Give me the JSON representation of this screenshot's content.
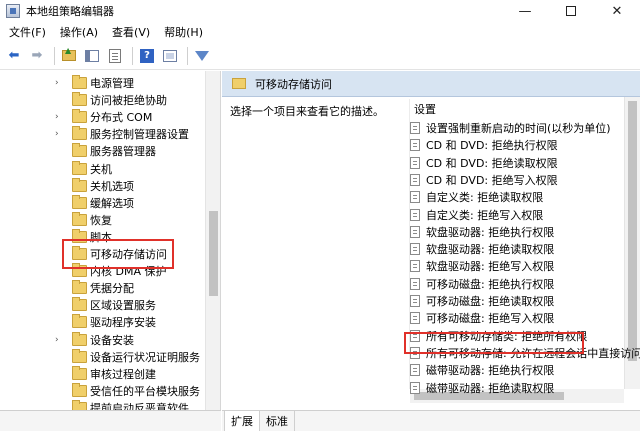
{
  "window": {
    "title": "本地组策略编辑器",
    "min": "—",
    "close": "✕"
  },
  "menu": [
    "文件(F)",
    "操作(A)",
    "查看(V)",
    "帮助(H)"
  ],
  "toolbar": {
    "icons": [
      "back-icon",
      "forward-icon",
      "folder-up-icon",
      "show-hide-tree-icon",
      "export-list-icon",
      "help-icon",
      "properties-icon",
      "filter-icon"
    ],
    "back_glyph": "⬅",
    "fwd_glyph": "➡"
  },
  "tree": {
    "items": [
      {
        "label": "电源管理",
        "arrow": "›"
      },
      {
        "label": "访问被拒绝协助",
        "arrow": ""
      },
      {
        "label": "分布式 COM",
        "arrow": "›"
      },
      {
        "label": "服务控制管理器设置",
        "arrow": "›"
      },
      {
        "label": "服务器管理器",
        "arrow": ""
      },
      {
        "label": "关机",
        "arrow": ""
      },
      {
        "label": "关机选项",
        "arrow": ""
      },
      {
        "label": "缓解选项",
        "arrow": ""
      },
      {
        "label": "恢复",
        "arrow": ""
      },
      {
        "label": "脚本",
        "arrow": ""
      },
      {
        "label": "可移动存储访问",
        "arrow": "",
        "selected": true
      },
      {
        "label": "内核 DMA 保护",
        "arrow": ""
      },
      {
        "label": "凭据分配",
        "arrow": ""
      },
      {
        "label": "区域设置服务",
        "arrow": ""
      },
      {
        "label": "驱动程序安装",
        "arrow": ""
      },
      {
        "label": "设备安装",
        "arrow": "›"
      },
      {
        "label": "设备运行状况证明服务",
        "arrow": ""
      },
      {
        "label": "审核过程创建",
        "arrow": ""
      },
      {
        "label": "受信任的平台模块服务",
        "arrow": ""
      },
      {
        "label": "提前启动反恶意软件",
        "arrow": ""
      }
    ]
  },
  "right": {
    "header_title": "可移动存储访问",
    "description": "选择一个项目来查看它的描述。",
    "column_header": "设置",
    "settings": [
      "设置强制重新启动的时间(以秒为单位)",
      "CD 和 DVD: 拒绝执行权限",
      "CD 和 DVD: 拒绝读取权限",
      "CD 和 DVD: 拒绝写入权限",
      "自定义类: 拒绝读取权限",
      "自定义类: 拒绝写入权限",
      "软盘驱动器: 拒绝执行权限",
      "软盘驱动器: 拒绝读取权限",
      "软盘驱动器: 拒绝写入权限",
      "可移动磁盘: 拒绝执行权限",
      "可移动磁盘: 拒绝读取权限",
      "可移动磁盘: 拒绝写入权限",
      "所有可移动存储类: 拒绝所有权限",
      "所有可移动存储: 允许在远程会话中直接访问",
      "磁带驱动器: 拒绝执行权限",
      "磁带驱动器: 拒绝读取权限"
    ]
  },
  "tabs": [
    "扩展",
    "标准"
  ]
}
